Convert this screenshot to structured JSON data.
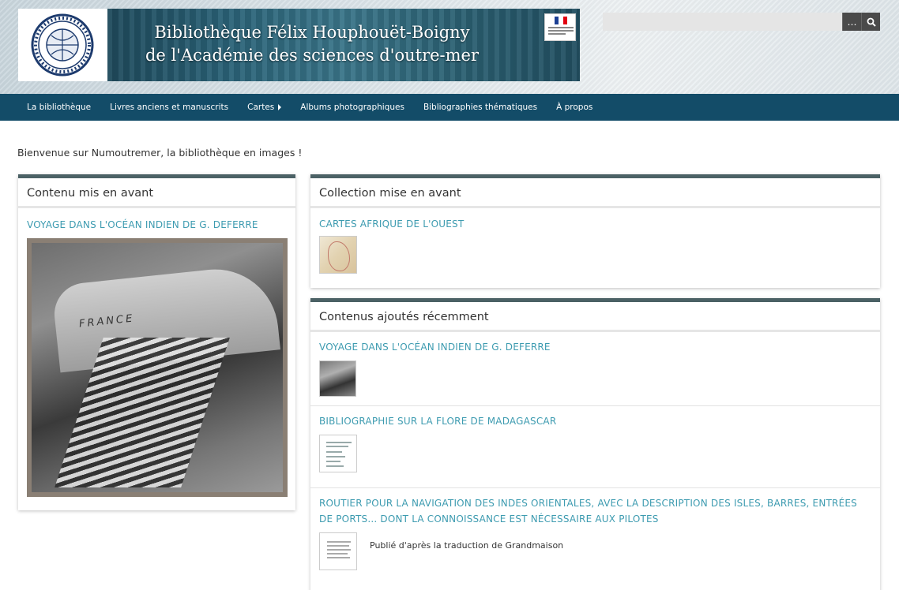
{
  "header": {
    "banner_line1": "Bibliothèque Félix Houphouët-Boigny",
    "banner_line2": "de l'Académie des sciences d'outre-mer",
    "colors": {
      "nav_bg": "#134c68",
      "link": "#3d9bb0",
      "panel_border": "#4b6165"
    }
  },
  "search": {
    "value": "",
    "placeholder": "",
    "options_label": "…",
    "search_icon": "search-icon"
  },
  "nav": {
    "items": [
      {
        "label": "La bibliothèque"
      },
      {
        "label": "Livres anciens et manuscrits"
      },
      {
        "label": "Cartes"
      },
      {
        "label": "Albums photographiques"
      },
      {
        "label": "Bibliographies thématiques"
      },
      {
        "label": "À propos"
      }
    ]
  },
  "welcome": "Bienvenue sur Numoutremer, la bibliothèque en images !",
  "featured": {
    "title": "Contenu mis en avant",
    "item_title": "Voyage dans l'Océan Indien de G. Deferre",
    "photo_text": "FRANCE"
  },
  "collection": {
    "title": "Collection mise en avant",
    "item_title": "Cartes Afrique de l'Ouest"
  },
  "recent": {
    "title": "Contenus ajoutés récemment",
    "items": [
      {
        "title": "Voyage dans l'Océan Indien de G. Deferre"
      },
      {
        "title": "Bibliographie sur la flore de Madagascar"
      },
      {
        "title": "Routier pour la navigation des Indes orientales, avec la description des isles, barres, entrées de ports... dont la connoissance est nécessaire aux pilotes",
        "description": "Publié d'après la traduction de Grandmaison"
      }
    ]
  }
}
